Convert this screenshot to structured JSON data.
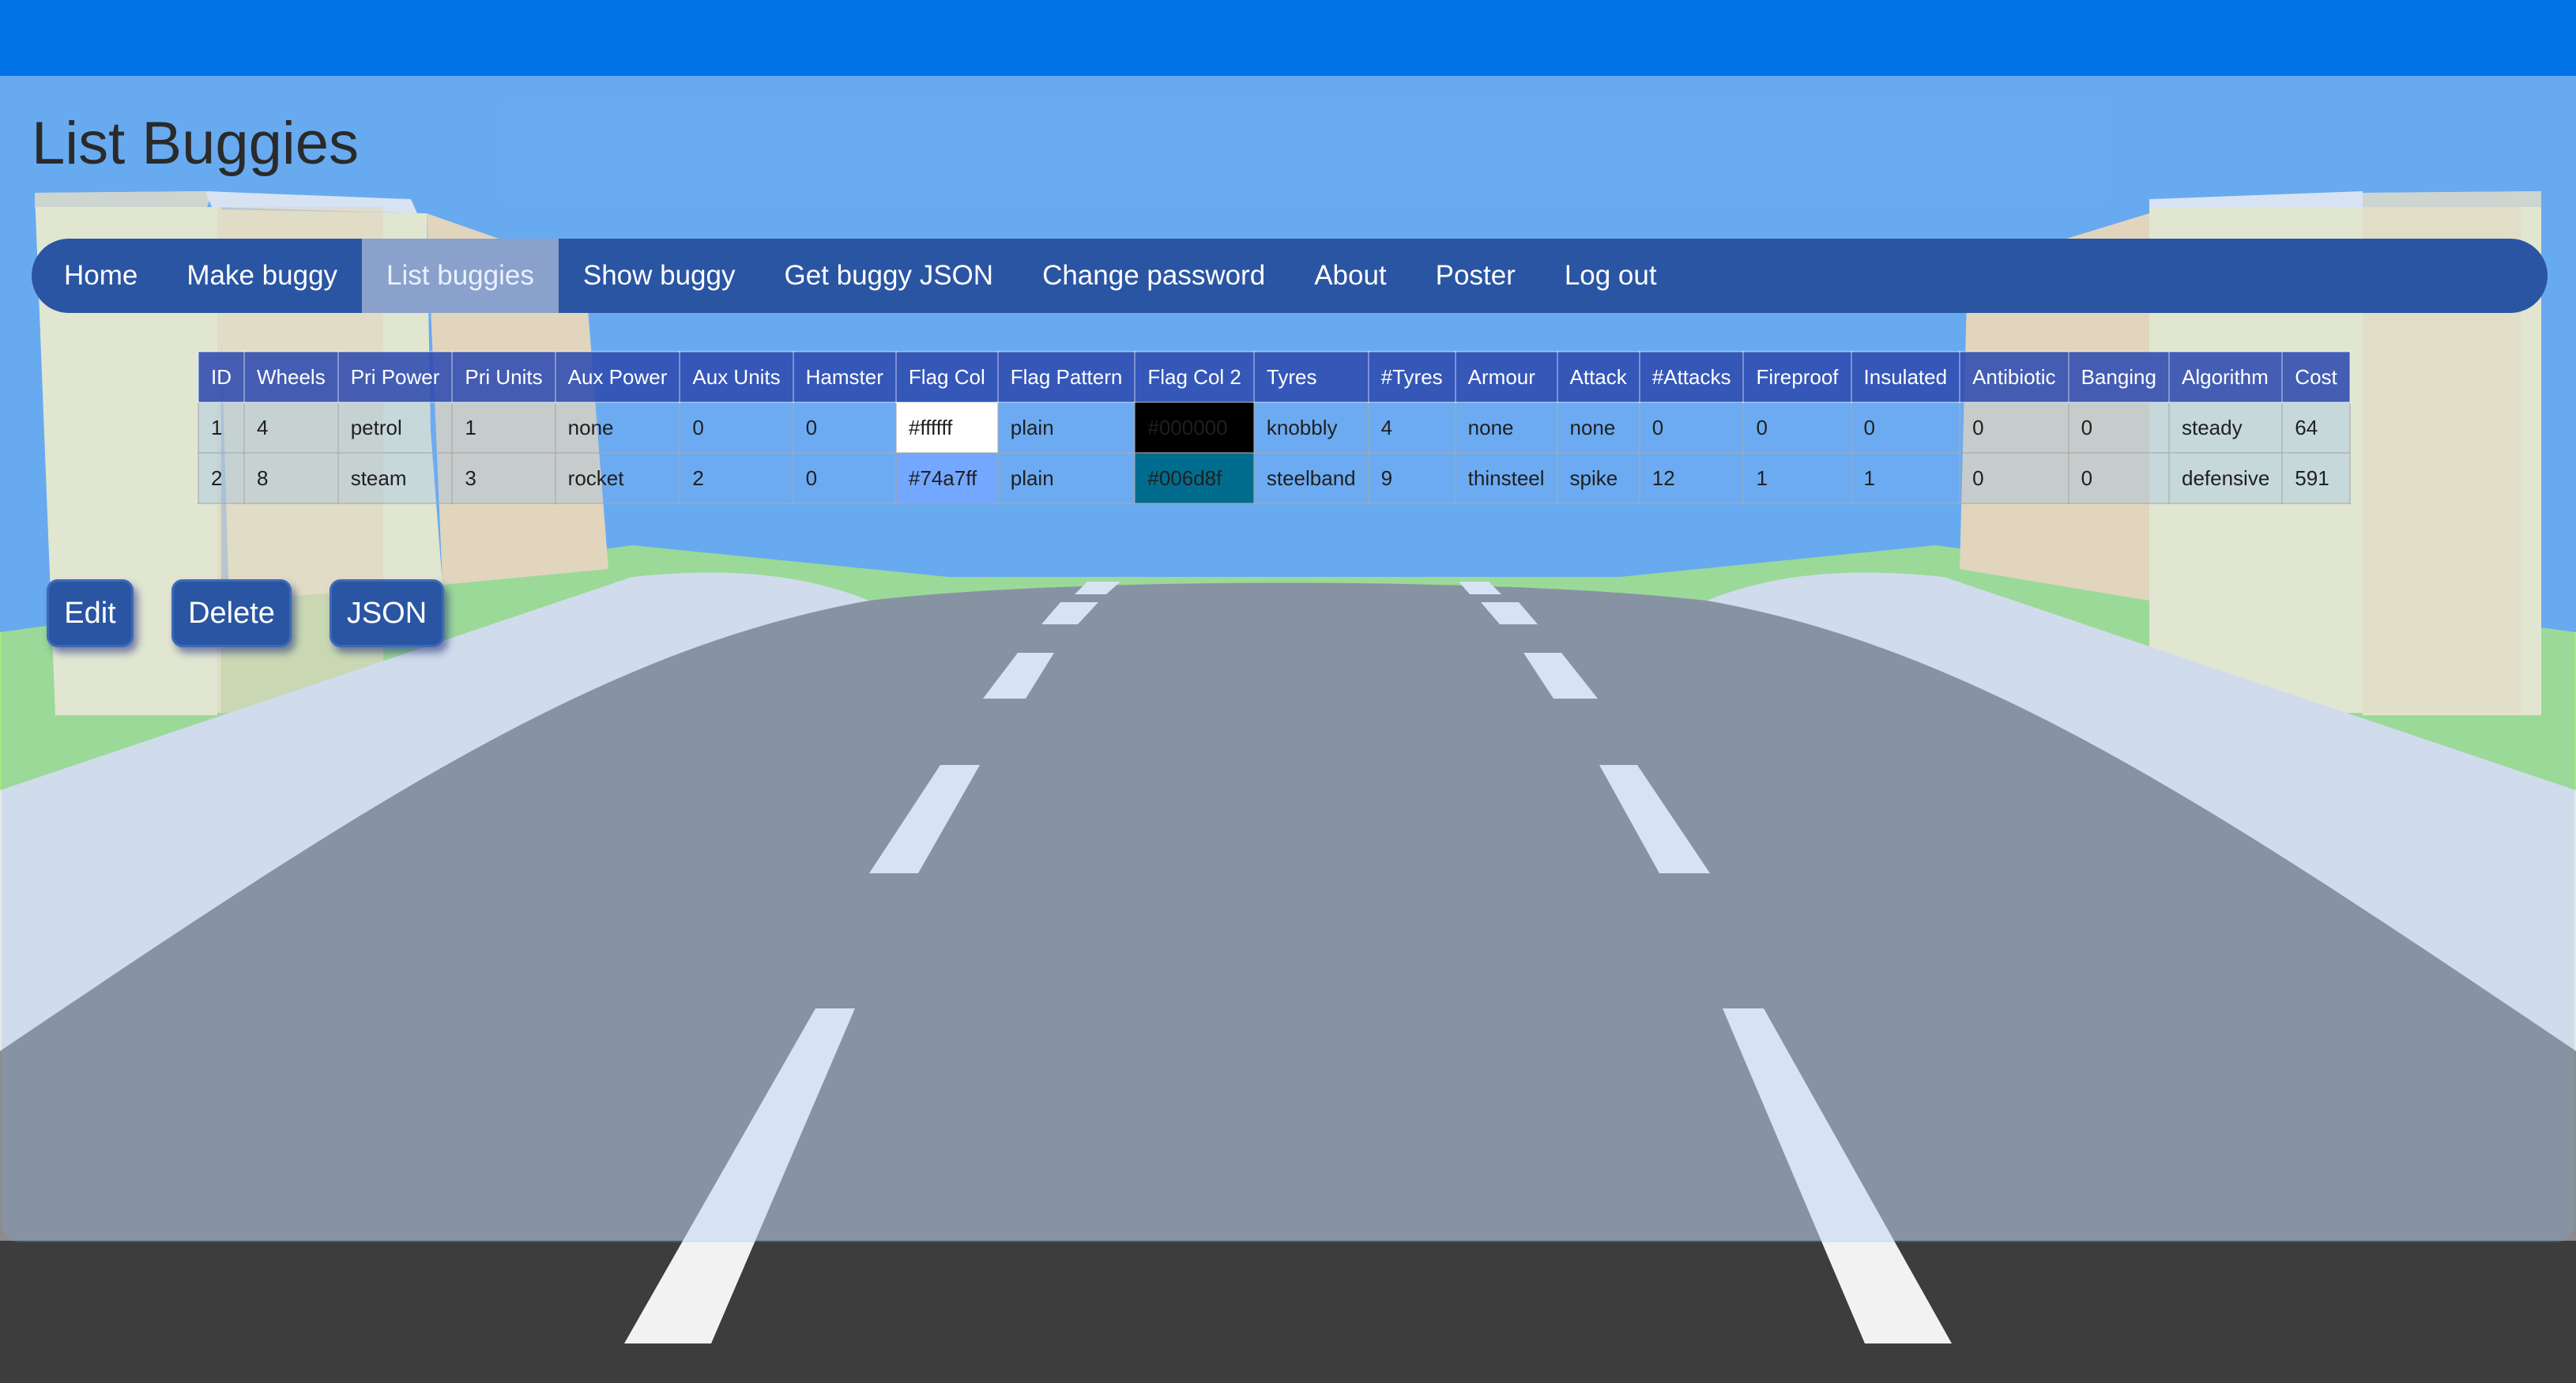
{
  "page": {
    "title": "List Buggies"
  },
  "nav": {
    "items": [
      {
        "label": "Home",
        "active": false
      },
      {
        "label": "Make buggy",
        "active": false
      },
      {
        "label": "List buggies",
        "active": true
      },
      {
        "label": "Show buggy",
        "active": false
      },
      {
        "label": "Get buggy JSON",
        "active": false
      },
      {
        "label": "Change password",
        "active": false
      },
      {
        "label": "About",
        "active": false
      },
      {
        "label": "Poster",
        "active": false
      },
      {
        "label": "Log out",
        "active": false
      }
    ]
  },
  "table": {
    "columns": [
      "ID",
      "Wheels",
      "Pri Power",
      "Pri Units",
      "Aux Power",
      "Aux Units",
      "Hamster",
      "Flag Col",
      "Flag Pattern",
      "Flag Col 2",
      "Tyres",
      "#Tyres",
      "Armour",
      "Attack",
      "#Attacks",
      "Fireproof",
      "Insulated",
      "Antibiotic",
      "Banging",
      "Algorithm",
      "Cost"
    ],
    "rows": [
      [
        "1",
        "4",
        "petrol",
        "1",
        "none",
        "0",
        "0",
        "#ffffff",
        "plain",
        "#000000",
        "knobbly",
        "4",
        "none",
        "none",
        "0",
        "0",
        "0",
        "0",
        "0",
        "steady",
        "64"
      ],
      [
        "2",
        "8",
        "steam",
        "3",
        "rocket",
        "2",
        "0",
        "#74a7ff",
        "plain",
        "#006d8f",
        "steelband",
        "9",
        "thinsteel",
        "spike",
        "12",
        "1",
        "1",
        "0",
        "0",
        "defensive",
        "591"
      ]
    ]
  },
  "buttons": {
    "edit": "Edit",
    "delete": "Delete",
    "json": "JSON"
  },
  "colors": {
    "topbar": "#0173e6",
    "navbar": "#2a55a3",
    "sky": "#65a9f0",
    "road": "#8c8c8c",
    "grass": "#a6e67f",
    "pillar": "#fff6c8"
  }
}
